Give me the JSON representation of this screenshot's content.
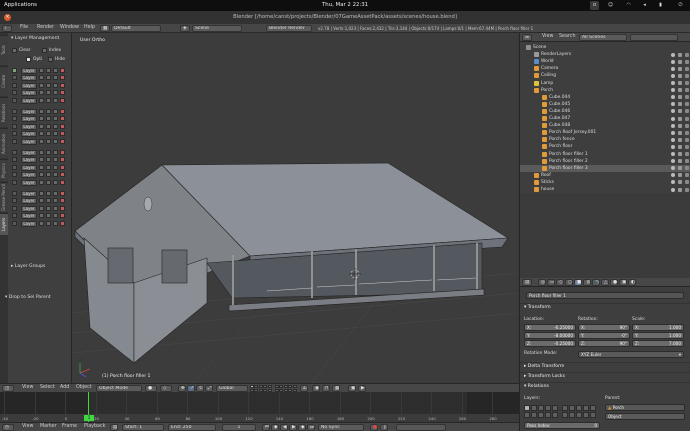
{
  "system_bar": {
    "applications": "Applications",
    "clock": "Thu, Mar 2  22:31"
  },
  "window": {
    "title": "Blender [/home/canst/projects/Blender/07GameAssetPack/assets/scenes/house.blend]"
  },
  "info_header": {
    "menus": [
      "File",
      "Render",
      "Window",
      "Help"
    ],
    "layout": "Default",
    "scene": "Scene",
    "engine": "Blender Render",
    "stats": "v2.78 | Verts:1,023 | Faces:2,432 | Tris:3,144 | Objects:0/174 | Lamps:0/1 | Mem:67.44M | Porch floor filler 1"
  },
  "left_tabs": [
    "Tools",
    "Create",
    "Relations",
    "Animation",
    "Physics",
    "Grease Pencil",
    "Layers"
  ],
  "tool_shelf": {
    "panel_title": "Layer Management",
    "clear_label": "Clear",
    "index_label": "Index",
    "opti_label": "Opti",
    "hide_label": "Hide",
    "layer_label": "Layer",
    "layer_rows": [
      1,
      2,
      3,
      4,
      5,
      6,
      7,
      8,
      9,
      10,
      11,
      12,
      13,
      14,
      15,
      16,
      17,
      18,
      19,
      20
    ],
    "layer_groups": "Layer Groups",
    "drop_label": "Drop to Sel Parent"
  },
  "viewport": {
    "label": "User Ortho",
    "selected_object": "(1) Porch floor filler 1"
  },
  "outliner": {
    "menus": [
      "View",
      "Search"
    ],
    "filter": "All Scenes",
    "items": [
      {
        "label": "Scene",
        "indent": 0,
        "icon": "scene-icon",
        "color": "#8f8f8f"
      },
      {
        "label": "RenderLayers",
        "indent": 1,
        "icon": "renderlayer-icon",
        "color": "#9a9a9a"
      },
      {
        "label": "World",
        "indent": 1,
        "icon": "world-icon",
        "color": "#5b8dc8"
      },
      {
        "label": "Camera",
        "indent": 1,
        "icon": "camera-icon",
        "color": "#e09a3a"
      },
      {
        "label": "Ceiling",
        "indent": 1,
        "icon": "mesh-icon",
        "color": "#e09a3a"
      },
      {
        "label": "Lamp",
        "indent": 1,
        "icon": "lamp-icon",
        "color": "#e0c23a"
      },
      {
        "label": "Porch",
        "indent": 1,
        "icon": "mesh-icon",
        "color": "#e09a3a"
      },
      {
        "label": "Cube.044",
        "indent": 2,
        "icon": "mesh-icon",
        "color": "#e09a3a"
      },
      {
        "label": "Cube.045",
        "indent": 2,
        "icon": "mesh-icon",
        "color": "#e09a3a"
      },
      {
        "label": "Cube.046",
        "indent": 2,
        "icon": "mesh-icon",
        "color": "#e09a3a"
      },
      {
        "label": "Cube.047",
        "indent": 2,
        "icon": "mesh-icon",
        "color": "#e09a3a"
      },
      {
        "label": "Cube.048",
        "indent": 2,
        "icon": "mesh-icon",
        "color": "#e09a3a"
      },
      {
        "label": "Porch Roof Jersey.001",
        "indent": 2,
        "icon": "mesh-icon",
        "color": "#e09a3a"
      },
      {
        "label": "Porch fence",
        "indent": 2,
        "icon": "mesh-icon",
        "color": "#e09a3a"
      },
      {
        "label": "Porch floor",
        "indent": 2,
        "icon": "mesh-icon",
        "color": "#e09a3a"
      },
      {
        "label": "Porch floor filler 1",
        "indent": 2,
        "icon": "mesh-icon",
        "color": "#e09a3a"
      },
      {
        "label": "Porch floor filler 2",
        "indent": 2,
        "icon": "mesh-icon",
        "color": "#e09a3a"
      },
      {
        "label": "Porch floor filler 3",
        "indent": 2,
        "icon": "mesh-icon",
        "color": "#e09a3a",
        "selected": true
      },
      {
        "label": "Roof",
        "indent": 1,
        "icon": "mesh-icon",
        "color": "#e09a3a"
      },
      {
        "label": "Sticks",
        "indent": 1,
        "icon": "mesh-icon",
        "color": "#e09a3a"
      },
      {
        "label": "house",
        "indent": 1,
        "icon": "mesh-icon",
        "color": "#e09a3a"
      }
    ]
  },
  "properties": {
    "object_name": "Porch floor filler 1",
    "transform": "Transform",
    "location_label": "Location:",
    "rotation_label": "Rotation:",
    "scale_label": "Scale:",
    "location": [
      {
        "axis": "X:",
        "value": "-6.25000"
      },
      {
        "axis": "Y:",
        "value": "-8.00000"
      },
      {
        "axis": "Z:",
        "value": "-0.25000"
      }
    ],
    "rotation": [
      {
        "axis": "X:",
        "value": "90°"
      },
      {
        "axis": "Y:",
        "value": "-0°"
      },
      {
        "axis": "Z:",
        "value": "90°"
      }
    ],
    "scale": [
      {
        "axis": "X:",
        "value": "1.000"
      },
      {
        "axis": "Y:",
        "value": "1.000"
      },
      {
        "axis": "Z:",
        "value": "7.000"
      }
    ],
    "rotation_mode_label": "Rotation Mode:",
    "rotation_mode": "XYZ Euler",
    "delta_transform": "Delta Transform",
    "transform_locks": "Transform Locks",
    "relations": "Relations",
    "layers_label": "Layers:",
    "parent_label": "Parent:",
    "parent_value": "Porch",
    "parent_type": "Object",
    "pass_index": "Pass Index:",
    "pass_value": "0"
  },
  "viewport_header": {
    "menus": [
      "View",
      "Select",
      "Add",
      "Object"
    ],
    "mode": "Object Mode",
    "pivot": "Global"
  },
  "timeline": {
    "ticks": [
      "-40",
      "-20",
      "0",
      "20",
      "40",
      "60",
      "80",
      "100",
      "120",
      "140",
      "160",
      "180",
      "200",
      "220",
      "240",
      "260",
      "280"
    ],
    "current_frame": "1",
    "menus": [
      "View",
      "Marker",
      "Frame",
      "Playback"
    ],
    "start_label": "Start:",
    "start_value": "1",
    "end_label": "End:",
    "end_value": "250",
    "frame_value": "1",
    "sync": "No Sync"
  }
}
